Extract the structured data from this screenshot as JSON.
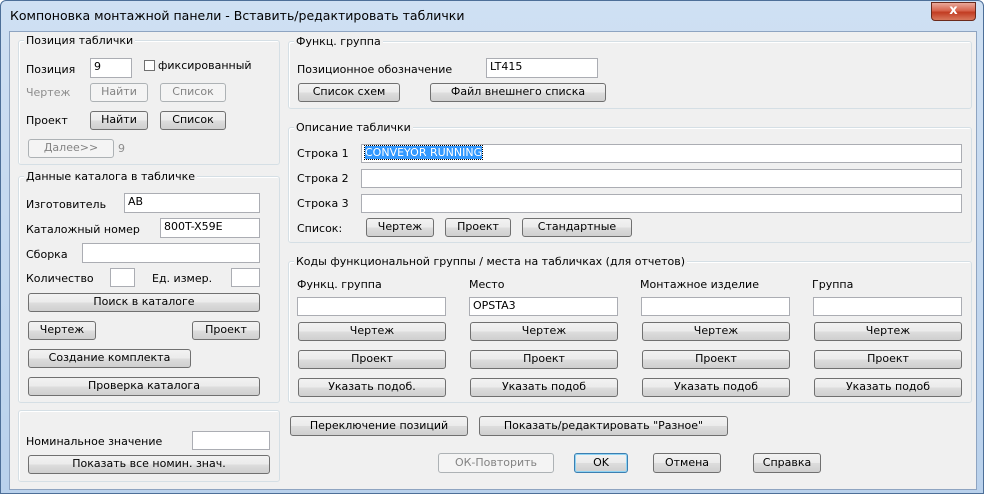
{
  "window": {
    "title": "Компоновка монтажной панели - Вставить/редактировать таблички",
    "close_glyph": "x"
  },
  "position_group": {
    "legend": "Позиция таблички",
    "position_label": "Позиция",
    "position_value": "9",
    "fixed_label": "фиксированный",
    "fixed_checked": false,
    "drawing_label": "Чертеж",
    "project_label": "Проект",
    "find_label": "Найти",
    "list_label": "Список",
    "next_label": "Далее>>",
    "next_value": "9"
  },
  "catalog_group": {
    "legend": "Данные каталога в табличке",
    "manufacturer_label": "Изготовитель",
    "manufacturer_value": "AB",
    "catalog_label": "Каталожный номер",
    "catalog_value": "800T-X59E",
    "assembly_label": "Сборка",
    "assembly_value": "",
    "quantity_label": "Количество",
    "quantity_value": "",
    "unit_label": "Ед. измер.",
    "unit_value": "",
    "catalog_lookup": "Поиск в каталоге",
    "drawing_btn": "Чертеж",
    "project_btn": "Проект",
    "create_kit": "Создание комплекта",
    "check_catalog": "Проверка каталога"
  },
  "nominal": {
    "label": "Номинальное значение",
    "value": "",
    "show_all": "Показать все номин. знач."
  },
  "func_group": {
    "legend": "Функц. группа",
    "tag_label": "Позиционное обозначение",
    "tag_value": "LT415",
    "schematic_list": "Список схем",
    "external_file": "Файл внешнего списка"
  },
  "description": {
    "legend": "Описание таблички",
    "line1_label": "Строка 1",
    "line1_value": "CONVEYOR RUNNING",
    "line2_label": "Строка 2",
    "line2_value": "",
    "line3_label": "Строка 3",
    "line3_value": "",
    "list_label": "Список:",
    "drawing_btn": "Чертеж",
    "project_btn": "Проект",
    "standard_btn": "Стандартные"
  },
  "codes": {
    "legend": "Коды функциональной группы / места на табличках  (для отчетов)",
    "columns": [
      {
        "label": "Функц. группа",
        "value": ""
      },
      {
        "label": "Место",
        "value": "OPSTA3"
      },
      {
        "label": "Монтажное изделие",
        "value": ""
      },
      {
        "label": "Группа",
        "value": ""
      }
    ],
    "drawing_btn": "Чертеж",
    "project_btn": "Проект",
    "pick_btns": [
      "Указать подоб.",
      "Указать подоб",
      "Указать подоб",
      "Указать подоб"
    ]
  },
  "bottom": {
    "toggle_positions": "Переключение позиций",
    "show_misc": "Показать/редактировать \"Разное\"",
    "ok_repeat": "ОК-Повторить",
    "ok": "OK",
    "cancel": "Отмена",
    "help": "Справка"
  }
}
